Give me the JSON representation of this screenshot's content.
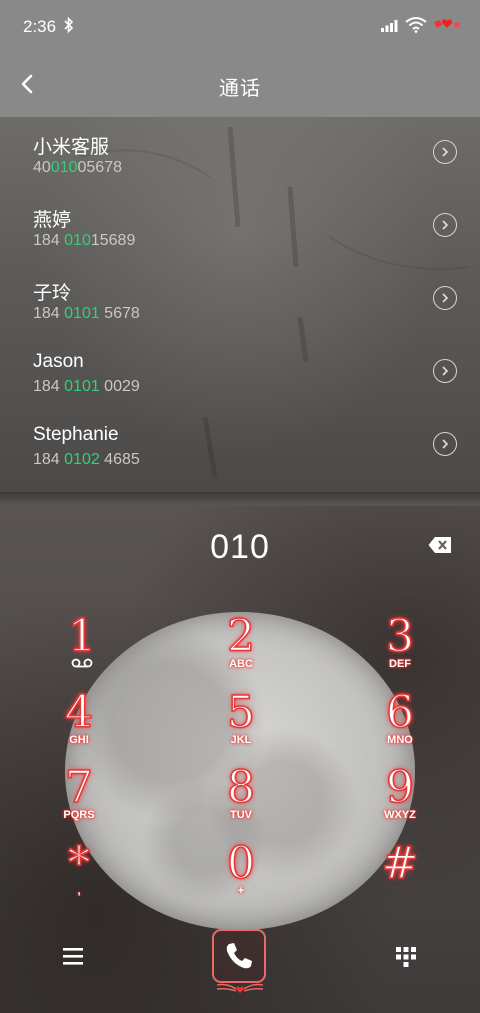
{
  "status_bar": {
    "time": "2:36",
    "icons": [
      "bluetooth-icon",
      "signal-icon",
      "wifi-icon",
      "battery-icon"
    ]
  },
  "header": {
    "title": "通话",
    "back_icon": "back-chevron-icon"
  },
  "contacts": [
    {
      "name": "小米客服",
      "number_pre": "40",
      "number_match": "010",
      "number_post": "05678"
    },
    {
      "name": "燕婷",
      "number_pre": "184 ",
      "number_match": "010",
      "number_post": "15689"
    },
    {
      "name": "子玲",
      "number_pre": "184 ",
      "number_match": "0101",
      "number_post": " 5678"
    },
    {
      "name": "Jason",
      "number_pre": "184 ",
      "number_match": "0101",
      "number_post": " 0029"
    },
    {
      "name": "Stephanie",
      "number_pre": "184 ",
      "number_match": "0102",
      "number_post": " 4685"
    }
  ],
  "dialer": {
    "number": "010",
    "keys": [
      {
        "digit": "1",
        "letters": ""
      },
      {
        "digit": "2",
        "letters": "ABC"
      },
      {
        "digit": "3",
        "letters": "DEF"
      },
      {
        "digit": "4",
        "letters": "GHI"
      },
      {
        "digit": "5",
        "letters": "JKL"
      },
      {
        "digit": "6",
        "letters": "MNO"
      },
      {
        "digit": "7",
        "letters": "PQRS"
      },
      {
        "digit": "8",
        "letters": "TUV"
      },
      {
        "digit": "9",
        "letters": "WXYZ"
      },
      {
        "digit": "*",
        "letters": ","
      },
      {
        "digit": "0",
        "letters": "+"
      },
      {
        "digit": "#",
        "letters": ""
      }
    ]
  },
  "colors": {
    "header_bg": "#8a8989",
    "match_highlight": "#2fd07a",
    "key_glow": "#e23a3a"
  }
}
